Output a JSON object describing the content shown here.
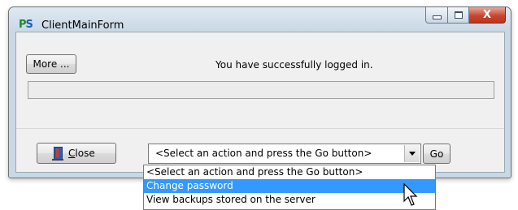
{
  "window": {
    "title": "ClientMainForm",
    "logo": {
      "p": "P",
      "s": "S"
    },
    "controls": {
      "close": "X"
    }
  },
  "main": {
    "more_label": "More ...",
    "status_message": "You have successfully logged in.",
    "progress_percent": 0
  },
  "bottom": {
    "close_label_accel": "C",
    "close_label_rest": "lose",
    "action_select_value": "<Select an action and press the Go button>",
    "go_label": "Go"
  },
  "dropdown": {
    "items": [
      "<Select an action and press the Go button>",
      "Change password",
      "View backups stored on the server"
    ],
    "highlighted_index": 1
  },
  "colors": {
    "selection": "#3399ff",
    "close_button": "#c9452f",
    "logo_p": "#1a8a2a",
    "logo_s": "#1a5fb4"
  }
}
